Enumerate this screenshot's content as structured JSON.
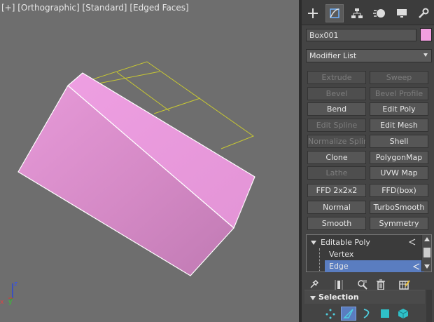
{
  "viewport": {
    "label_parts": [
      "[+]",
      "[Orthographic]",
      "[Standard]",
      "[Edged Faces]"
    ],
    "axis": {
      "x": "x",
      "y": "y",
      "z": "z"
    },
    "colors": {
      "background": "#6e6e6e",
      "box": "#f29ee0",
      "wireframe": "#c8c832"
    }
  },
  "command_panel": {
    "tabs": [
      {
        "id": "create",
        "icon": "plus-icon"
      },
      {
        "id": "modify",
        "icon": "modify-icon",
        "active": true
      },
      {
        "id": "hierarchy",
        "icon": "hierarchy-icon"
      },
      {
        "id": "motion",
        "icon": "motion-icon"
      },
      {
        "id": "display",
        "icon": "display-icon"
      },
      {
        "id": "utilities",
        "icon": "wrench-icon"
      }
    ],
    "object_name": "Box001",
    "object_color": "#f29ee0",
    "modifier_list": "Modifier List",
    "buttons": [
      {
        "label": "Extrude",
        "enabled": false
      },
      {
        "label": "Sweep",
        "enabled": false
      },
      {
        "label": "Bevel",
        "enabled": false
      },
      {
        "label": "Bevel Profile",
        "enabled": false
      },
      {
        "label": "Bend",
        "enabled": true
      },
      {
        "label": "Edit Poly",
        "enabled": true
      },
      {
        "label": "Edit Spline",
        "enabled": false
      },
      {
        "label": "Edit Mesh",
        "enabled": true
      },
      {
        "label": "Normalize Spline",
        "enabled": false
      },
      {
        "label": "Shell",
        "enabled": true
      },
      {
        "label": "Clone",
        "enabled": true
      },
      {
        "label": "PolygonMap",
        "enabled": true
      },
      {
        "label": "Lathe",
        "enabled": false
      },
      {
        "label": "UVW Map",
        "enabled": true
      },
      {
        "label": "FFD 2x2x2",
        "enabled": true
      },
      {
        "label": "FFD(box)",
        "enabled": true
      },
      {
        "label": "Normal",
        "enabled": true
      },
      {
        "label": "TurboSmooth",
        "enabled": true
      },
      {
        "label": "Smooth",
        "enabled": true
      },
      {
        "label": "Symmetry",
        "enabled": true
      }
    ],
    "stack": {
      "root": "Editable Poly",
      "children": [
        "Vertex",
        "Edge"
      ],
      "selected": "Edge",
      "selection_color": "#5a7dc0"
    },
    "stack_tools": [
      "pin-icon",
      "show-end-result-icon",
      "make-unique-icon",
      "remove-modifier-icon",
      "configure-icon"
    ],
    "rollout": {
      "title": "Selection",
      "modes": [
        {
          "icon": "vertex-icon"
        },
        {
          "icon": "edge-icon",
          "active": true
        },
        {
          "icon": "border-icon"
        },
        {
          "icon": "polygon-icon"
        },
        {
          "icon": "element-icon"
        }
      ]
    }
  }
}
